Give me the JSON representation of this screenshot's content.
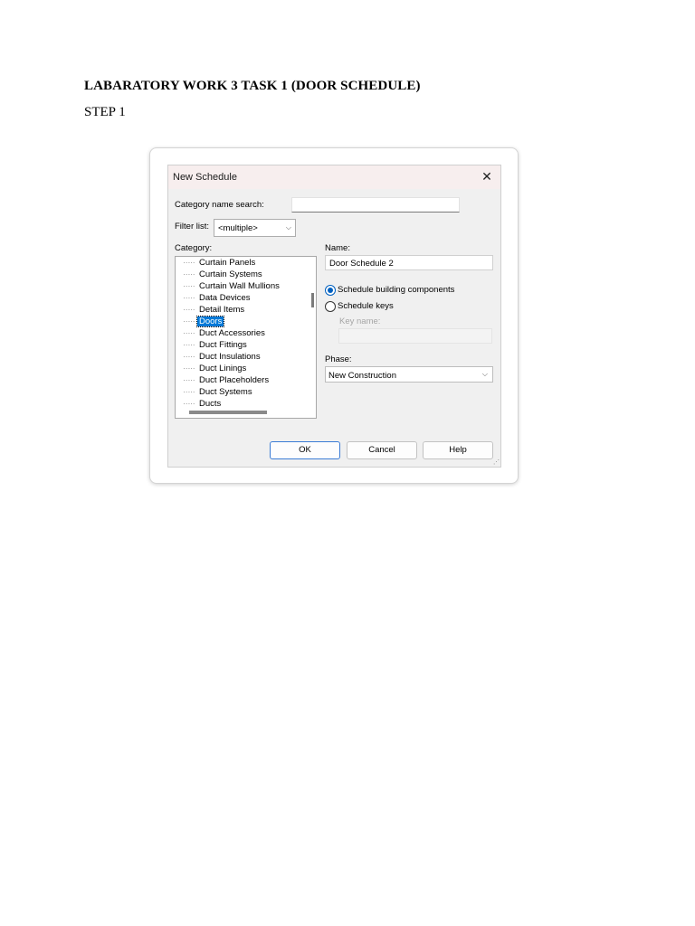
{
  "document": {
    "title": "LABARATORY WORK 3 TASK 1 (DOOR SCHEDULE)",
    "step": "STEP 1"
  },
  "dialog": {
    "title": "New Schedule",
    "category_search_label": "Category name search:",
    "category_search_value": "",
    "filter_label": "Filter list:",
    "filter_value": "<multiple>",
    "category_label": "Category:",
    "categories": [
      {
        "label": "Curtain Panels",
        "selected": false
      },
      {
        "label": "Curtain Systems",
        "selected": false
      },
      {
        "label": "Curtain Wall Mullions",
        "selected": false
      },
      {
        "label": "Data Devices",
        "selected": false
      },
      {
        "label": "Detail Items",
        "selected": false
      },
      {
        "label": "Doors",
        "selected": true
      },
      {
        "label": "Duct Accessories",
        "selected": false
      },
      {
        "label": "Duct Fittings",
        "selected": false
      },
      {
        "label": "Duct Insulations",
        "selected": false
      },
      {
        "label": "Duct Linings",
        "selected": false
      },
      {
        "label": "Duct Placeholders",
        "selected": false
      },
      {
        "label": "Duct Systems",
        "selected": false
      },
      {
        "label": "Ducts",
        "selected": false
      }
    ],
    "name_label": "Name:",
    "name_value": "Door Schedule 2",
    "radio_components": "Schedule building components",
    "radio_keys": "Schedule keys",
    "radio_selected": "components",
    "key_name_label": "Key name:",
    "phase_label": "Phase:",
    "phase_value": "New Construction",
    "ok_label": "OK",
    "cancel_label": "Cancel",
    "help_label": "Help"
  }
}
